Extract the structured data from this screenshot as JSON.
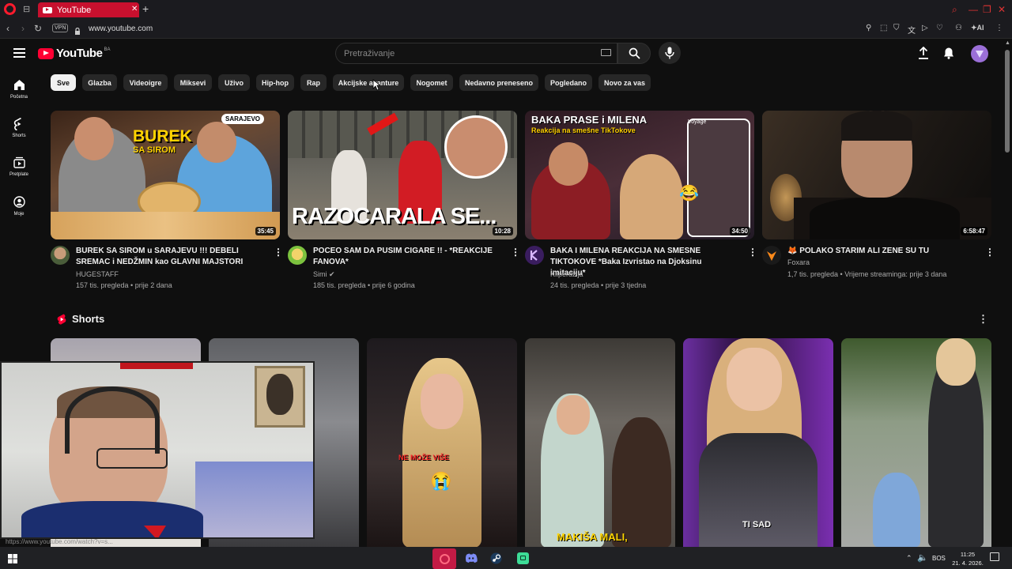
{
  "browser": {
    "tab_title": "YouTube",
    "url": "www.youtube.com",
    "vpn_label": "VPN",
    "ai_label": "AI"
  },
  "header": {
    "logo_text": "YouTube",
    "country_code": "BA",
    "search_placeholder": "Pretraživanje"
  },
  "sidebar": {
    "items": [
      {
        "label": "Početna",
        "icon": "home-icon"
      },
      {
        "label": "Shorts",
        "icon": "shorts-icon"
      },
      {
        "label": "Pretplate",
        "icon": "subscriptions-icon"
      },
      {
        "label": "Moje",
        "icon": "you-icon"
      }
    ]
  },
  "chips": [
    "Sve",
    "Glazba",
    "Videoigre",
    "Miksevi",
    "Uživo",
    "Hip-hop",
    "Rap",
    "Akcijske avanture",
    "Nogomet",
    "Nedavno preneseno",
    "Pogledano",
    "Novo za vas"
  ],
  "videos": [
    {
      "title": "BUREK SA SIROM u SARAJEVU !!! DEBELI SREMAC i NEDŽMIN kao GLAVNI MAJSTORI",
      "channel": "HUGESTAFF",
      "meta": "157 tis. pregleda • prije 2 dana",
      "duration": "35:45",
      "thumb_text_1": "BUREK",
      "thumb_text_2": "SA SIROM",
      "thumb_badge": "SARAJEVO"
    },
    {
      "title": "POCEO SAM DA PUSIM CIGARE !! - *REAKCIJE FANOVA*",
      "channel": "Simi",
      "meta": "185 tis. pregleda • prije 6 godina",
      "duration": "10:28",
      "thumb_text_1": "RAZOCARALA SE..."
    },
    {
      "title": "BAKA I MILENA REAKCIJA NA SMESNE TIKTOKOVE *Baka Izvristao na Djoksinu imitaciju*",
      "channel": "Kliperdzija",
      "meta": "24 tis. pregleda • prije 3 tjedna",
      "duration": "34:50",
      "thumb_text_1": "BAKA PRASE i MILENA",
      "thumb_text_2": "Reakcija na smešne TikTokove",
      "thumb_badge": "Voyage"
    },
    {
      "title": "POLAKO STARIM ALI ZENE SU TU",
      "channel": "Foxara",
      "meta_1": "1,7 tis. pregleda • Vrijeme streaminga: prije 3 dana",
      "duration": "6:58:47"
    }
  ],
  "shorts": {
    "title": "Shorts",
    "captions": [
      "NE MOŽE VIŠE",
      "MAKIŠA MALI,",
      "TI SAD"
    ]
  },
  "status_url": "https://www.youtube.com/watch?v=s...",
  "taskbar": {
    "lang": "BOS",
    "time": "11:25",
    "date": "21. 4. 2026."
  },
  "colors": {
    "accent": "#ff0033",
    "opera_tab": "#c8102e",
    "bg": "#0f0f0f"
  }
}
